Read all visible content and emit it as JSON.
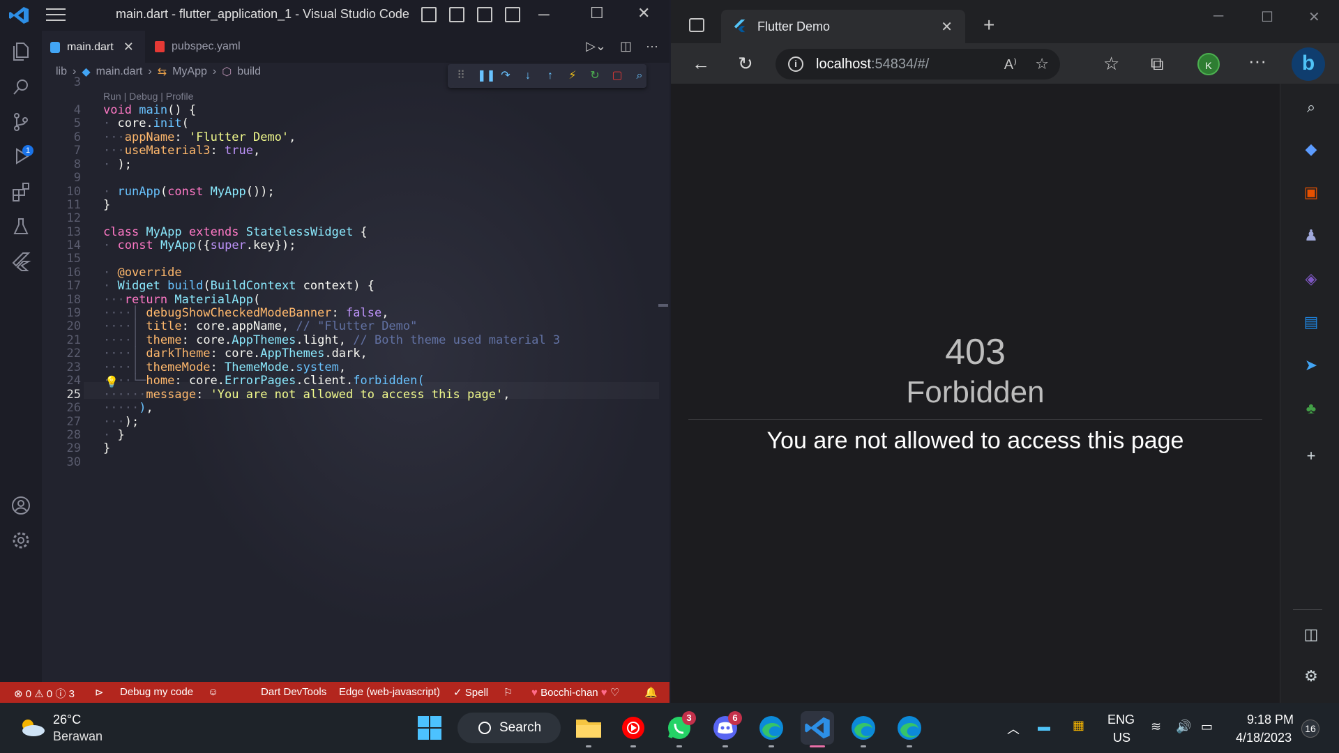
{
  "vscode": {
    "window_title": "main.dart - flutter_application_1 - Visual Studio Code",
    "tabs": [
      {
        "label": "main.dart",
        "active": true
      },
      {
        "label": "pubspec.yaml",
        "active": false
      }
    ],
    "breadcrumb": [
      "lib",
      "main.dart",
      "MyApp",
      "build"
    ],
    "code_lens": "Run | Debug | Profile",
    "line_numbers": [
      "3",
      "4",
      "5",
      "6",
      "7",
      "8",
      "9",
      "10",
      "11",
      "12",
      "13",
      "14",
      "15",
      "16",
      "17",
      "18",
      "19",
      "20",
      "21",
      "22",
      "23",
      "24",
      "25",
      "26",
      "27",
      "28",
      "29",
      "30"
    ],
    "current_line": "25",
    "debug_badge": "1",
    "status": {
      "errors": "0",
      "warnings": "0",
      "info": "3",
      "debug": "Debug my code",
      "devtools": "Dart DevTools",
      "device": "Edge (web-javascript)",
      "spell": "Spell",
      "theme": "Bocchi-chan"
    }
  },
  "edge": {
    "tab_title": "Flutter Demo",
    "url_host": "localhost",
    "url_rest": ":54834/#/",
    "profile_initial": "K",
    "page": {
      "code": "403",
      "title": "Forbidden",
      "message": "You are not allowed to access this page"
    }
  },
  "taskbar": {
    "weather_temp": "26°C",
    "weather_desc": "Berawan",
    "search_label": "Search",
    "whatsapp_badge": "3",
    "discord_badge": "6",
    "lang_1": "ENG",
    "lang_2": "US",
    "time": "9:18 PM",
    "date": "4/18/2023",
    "notifications": "16"
  }
}
